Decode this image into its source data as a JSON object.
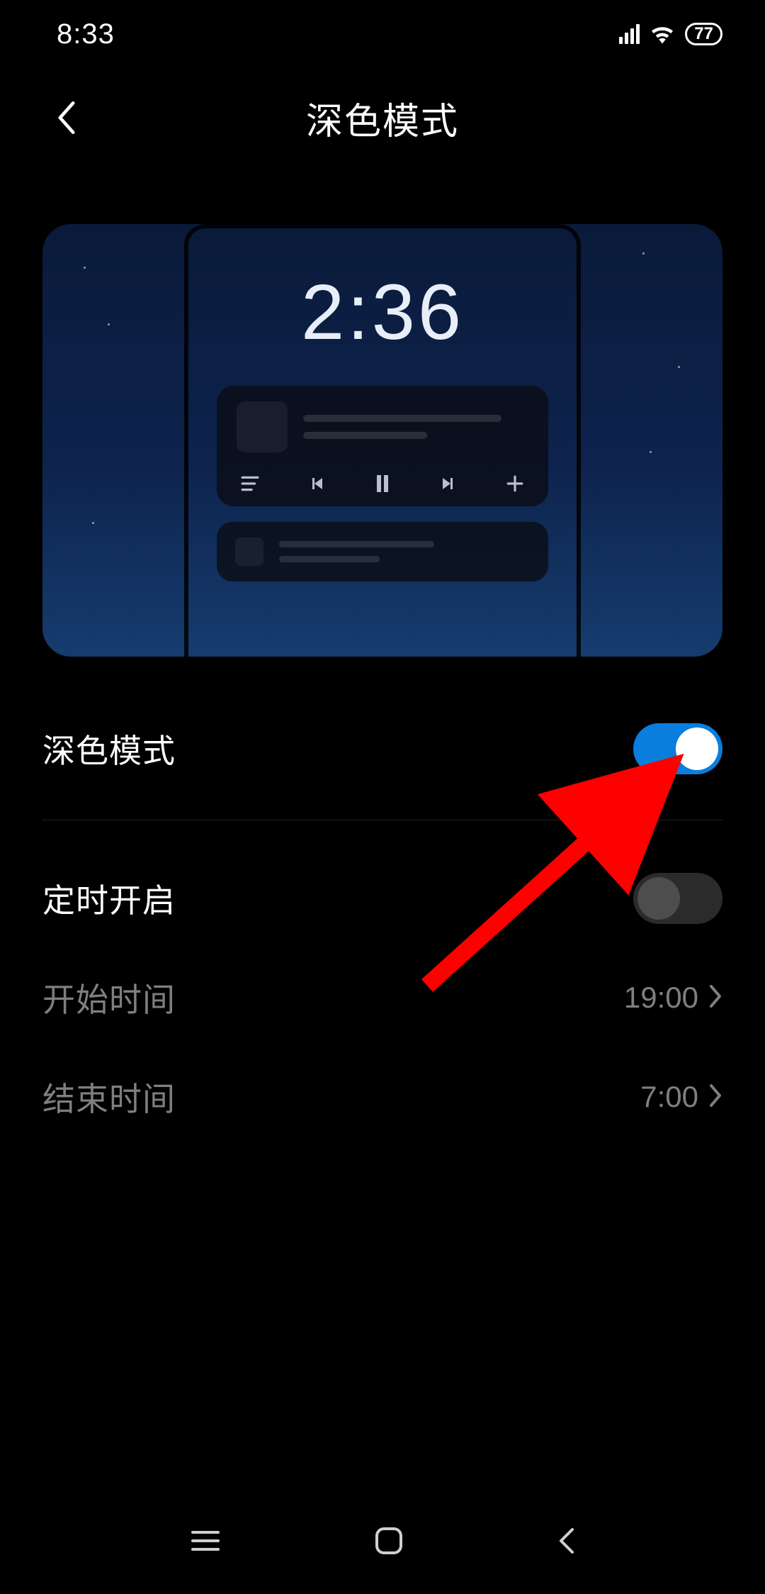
{
  "status": {
    "time": "8:33",
    "battery": "77"
  },
  "header": {
    "title": "深色模式"
  },
  "preview": {
    "time": "2:36"
  },
  "settings": {
    "dark_mode": {
      "label": "深色模式",
      "value": true
    },
    "schedule": {
      "label": "定时开启",
      "value": false
    },
    "start_time": {
      "label": "开始时间",
      "value": "19:00"
    },
    "end_time": {
      "label": "结束时间",
      "value": "7:00"
    }
  },
  "annotation": {
    "target": "dark-mode-toggle",
    "color": "#ff0000"
  }
}
